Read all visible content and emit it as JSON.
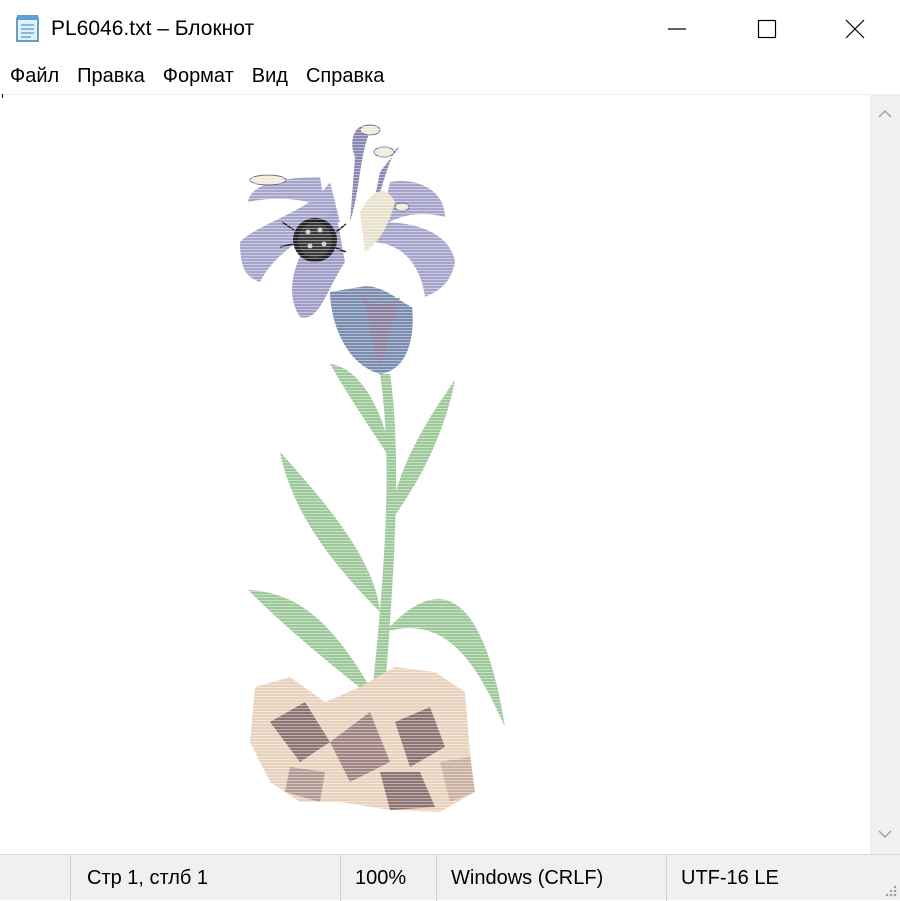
{
  "window": {
    "title": "PL6046.txt – Блокнот"
  },
  "menu": {
    "items": [
      "Файл",
      "Правка",
      "Формат",
      "Вид",
      "Справка"
    ]
  },
  "status": {
    "position": "Стр 1, стлб 1",
    "zoom": "100%",
    "line_ending": "Windows (CRLF)",
    "encoding": "UTF-16 LE"
  },
  "colors": {
    "petal": "#a7a4cc",
    "petal_dark": "#7a78a6",
    "stem": "#9cc89a",
    "rock_light": "#e8d2bd",
    "rock_dark": "#8c7472"
  },
  "icons": {
    "app": "notepad-icon",
    "minimize": "minimize-icon",
    "maximize": "maximize-icon",
    "close": "close-icon"
  }
}
